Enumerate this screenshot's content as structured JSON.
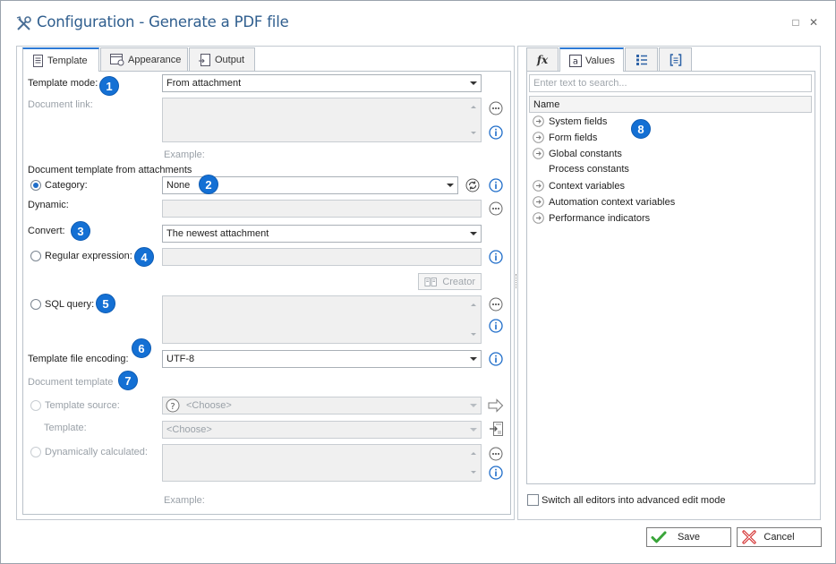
{
  "window": {
    "title": "Configuration - Generate a PDF file",
    "maximize_glyph": "□",
    "close_glyph": "✕"
  },
  "left_tabs": [
    {
      "label": "Template",
      "icon": "template-doc-icon",
      "active": true
    },
    {
      "label": "Appearance",
      "icon": "appearance-icon",
      "active": false
    },
    {
      "label": "Output",
      "icon": "output-icon",
      "active": false
    }
  ],
  "form": {
    "template_mode_label": "Template mode:",
    "template_mode_value": "From attachment",
    "document_link_label": "Document link:",
    "example_label": "Example:",
    "doc_template_from_attachments": "Document template from attachments",
    "category_label": "Category:",
    "category_value": "None",
    "dynamic_label": "Dynamic:",
    "convert_label": "Convert:",
    "convert_value": "The newest attachment",
    "regex_label": "Regular expression:",
    "creator_label": "Creator",
    "sql_label": "SQL query:",
    "encoding_label": "Template file encoding:",
    "encoding_value": "UTF-8",
    "document_template_label": "Document template",
    "template_source_label": "Template source:",
    "template_source_value": "<Choose>",
    "template_label": "Template:",
    "template_value": "<Choose>",
    "dynamically_calculated_label": "Dynamically calculated:",
    "example2_label": "Example:"
  },
  "badges": [
    "1",
    "2",
    "3",
    "4",
    "5",
    "6",
    "7",
    "8"
  ],
  "right_tabs": [
    {
      "label": "fx",
      "icon": "function-icon",
      "active": false
    },
    {
      "label": "Values",
      "icon": "values-icon",
      "active": true
    },
    {
      "label": "",
      "icon": "list-icon",
      "active": false
    },
    {
      "label": "",
      "icon": "bracket-icon",
      "active": false
    }
  ],
  "values_panel": {
    "search_placeholder": "Enter text to search...",
    "header": "Name",
    "items": [
      {
        "label": "System fields",
        "expandable": true
      },
      {
        "label": "Form fields",
        "expandable": true
      },
      {
        "label": "Global constants",
        "expandable": true
      },
      {
        "label": "Process constants",
        "expandable": false
      },
      {
        "label": "Context variables",
        "expandable": true
      },
      {
        "label": "Automation context variables",
        "expandable": true
      },
      {
        "label": "Performance indicators",
        "expandable": true
      }
    ]
  },
  "advanced_mode_label": "Switch all editors into advanced edit mode",
  "footer": {
    "save_label": "Save",
    "cancel_label": "Cancel"
  },
  "colors": {
    "title": "#2f5e8e",
    "badge": "#1470d4",
    "accent": "#2d7ad6",
    "save_check": "#3aa53a",
    "cancel_x": "#d22a2a"
  }
}
